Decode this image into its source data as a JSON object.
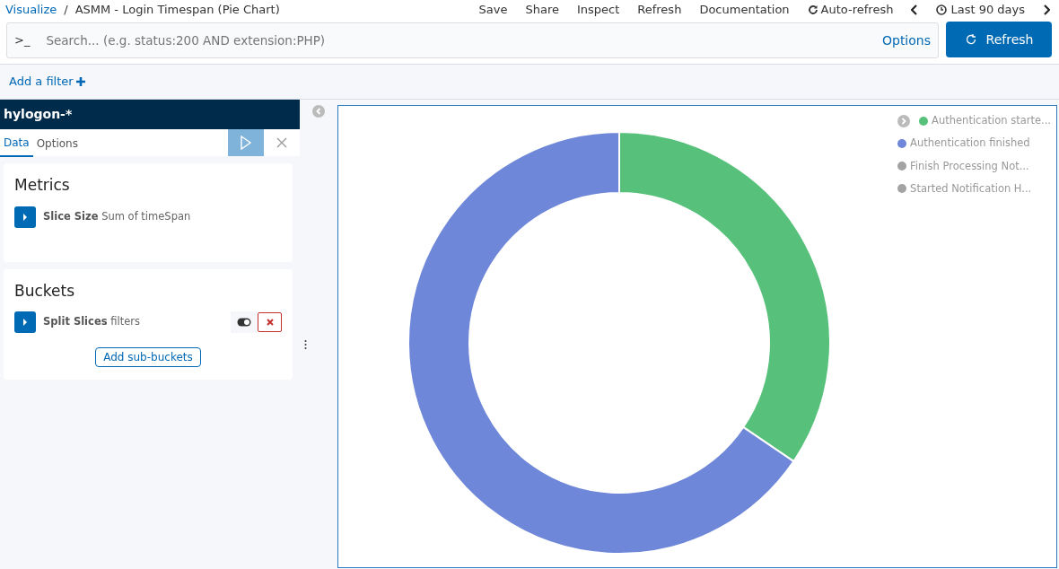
{
  "breadcrumb": {
    "parent": "Visualize",
    "separator": "/",
    "title": "ASMM - Login Timespan (Pie Chart)"
  },
  "top_menu": [
    "Save",
    "Share",
    "Inspect",
    "Refresh",
    "Documentation"
  ],
  "auto_refresh": "Auto-refresh",
  "time_range": "Last 90 days",
  "query_bar": {
    "prompt": ">_",
    "placeholder": "Search... (e.g. status:200 AND extension:PHP)",
    "options": "Options",
    "refresh_button": "Refresh"
  },
  "add_filter": "Add a filter",
  "editor": {
    "index_pattern": "hylogon-*",
    "tabs": [
      {
        "label": "Data",
        "selected": true
      },
      {
        "label": "Options",
        "selected": false
      }
    ],
    "sections": [
      {
        "title": "Metrics",
        "aggs": [
          {
            "name": "Slice Size",
            "desc": "Sum of timeSpan"
          }
        ]
      },
      {
        "title": "Buckets",
        "aggs": [
          {
            "name": "Split Slices",
            "desc": "filters",
            "removable": true,
            "enabled": true
          }
        ],
        "add_button": "Add sub-buckets"
      }
    ]
  },
  "legend": [
    {
      "label": "Authentication starte...",
      "color": "#57c17b"
    },
    {
      "label": "Authentication finished",
      "color": "#6f87d8"
    },
    {
      "label": "Finish Processing Not...",
      "color": "#a3a3a3"
    },
    {
      "label": "Started Notification H...",
      "color": "#a3a3a3"
    }
  ]
}
